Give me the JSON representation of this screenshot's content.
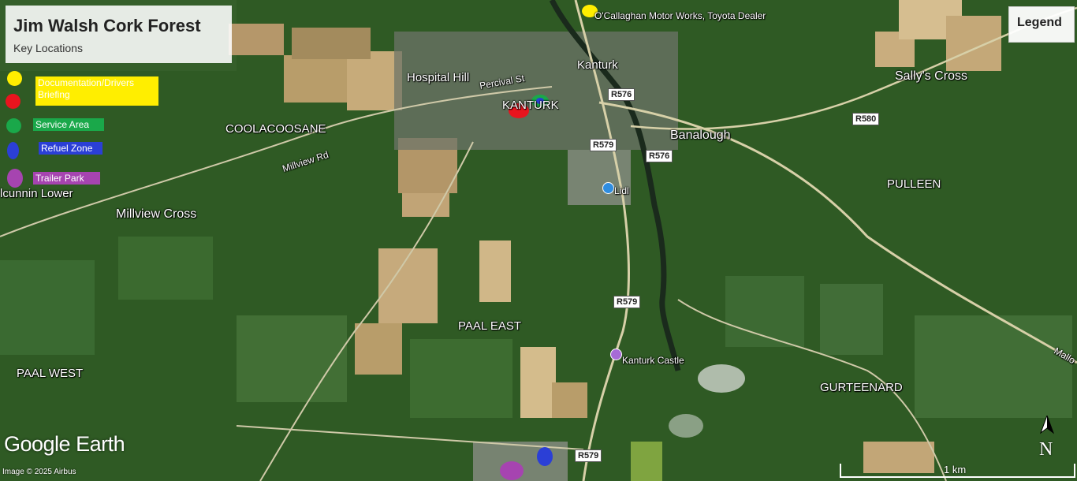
{
  "title": {
    "heading": "Jim Walsh Cork Forest",
    "subheading": "Key Locations"
  },
  "legend_button": "Legend",
  "legend": {
    "items": [
      {
        "label": "Documentation/Drivers Briefing",
        "color": "#ffee00"
      },
      {
        "label": "Service Area",
        "color": "#1aa84a"
      },
      {
        "label": "Refuel Zone",
        "color": "#2b3fd6"
      },
      {
        "label": "Trailer Park",
        "color": "#a644b0"
      }
    ],
    "red_marker_color": "#e8141e"
  },
  "place_labels": {
    "kanturk": "Kanturk",
    "hospital_hill": "Hospital Hill",
    "percival_st": "Percival St",
    "kanturk_town": "KANTURK",
    "coolacoosane": "COOLACOOSANE",
    "millview_rd": "Millview Rd",
    "cunnin_lower": "lcunnin Lower",
    "millview_cross": "Millview Cross",
    "banalough": "Banalough",
    "sallys_cross": "Sally's Cross",
    "pulleen": "PULLEEN",
    "paal_east": "PAAL EAST",
    "paal_west": "PAAL WEST",
    "gurteenard": "GURTEENARD",
    "mallow": "Mallo",
    "lidl": "Lidl",
    "kanturk_castle": "Kanturk Castle",
    "toyota": "O'Callaghan Motor Works, Toyota Dealer"
  },
  "road_shields": [
    "R576",
    "R579",
    "R576",
    "R580",
    "R579",
    "R579"
  ],
  "footer": {
    "logo": "Google Earth",
    "credit": "Image © 2025 Airbus",
    "scale": "1 km",
    "north": "N"
  }
}
